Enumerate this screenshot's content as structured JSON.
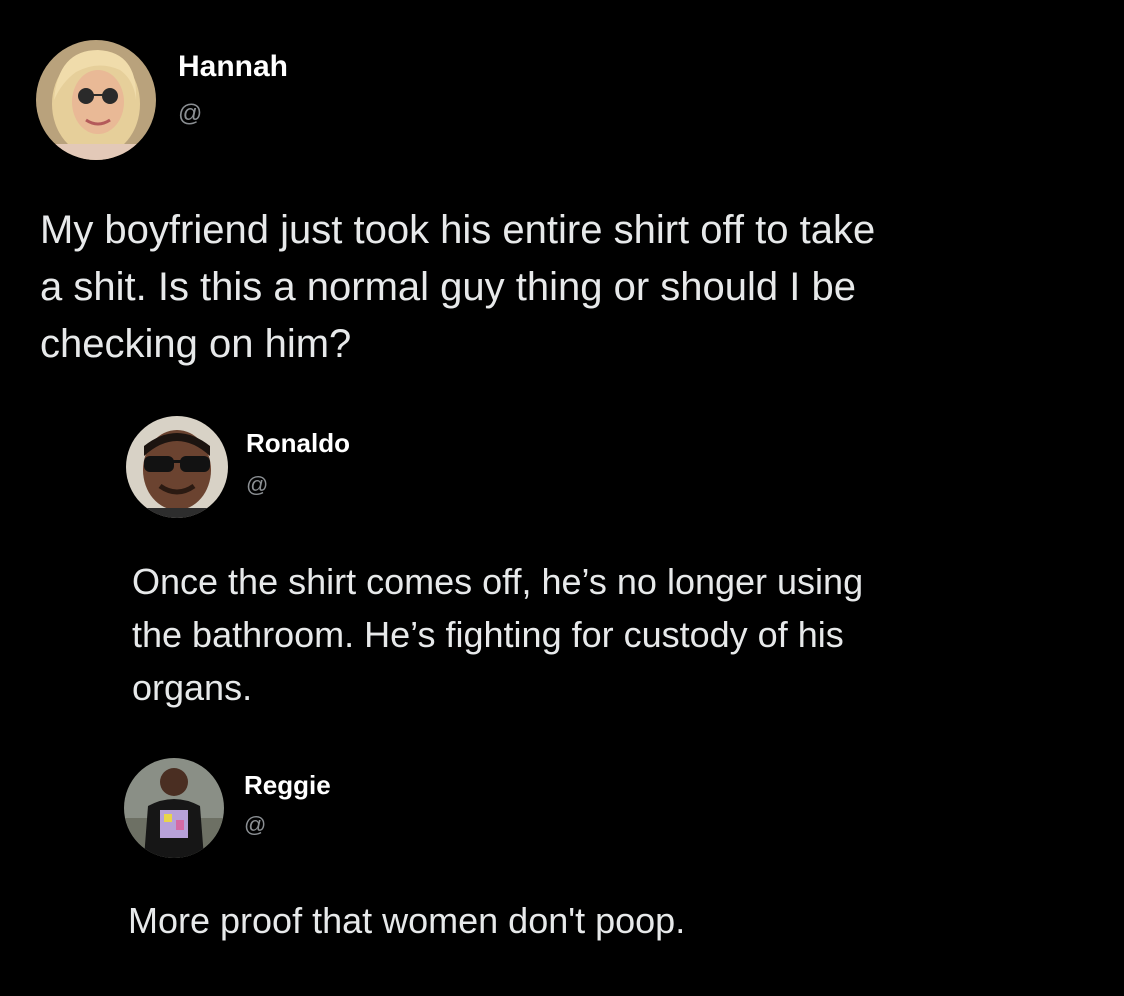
{
  "tweets": [
    {
      "name": "Hannah",
      "handle": "@",
      "avatar": "profile-photo-woman-sunglasses",
      "text": "My boyfriend just took his entire shirt off to take\na shit. Is this a normal guy thing or should I be\nchecking on him?"
    },
    {
      "name": "Ronaldo",
      "handle": "@",
      "avatar": "profile-photo-man-sunglasses",
      "text": "Once the shirt comes off, he’s no longer using\nthe bathroom. He’s fighting for custody of his\norgans."
    },
    {
      "name": "Reggie",
      "handle": "@",
      "avatar": "profile-photo-man-graphic-tee",
      "text": "More proof that women don't poop."
    }
  ],
  "colors": {
    "background": "#000000",
    "name": "#ffffff",
    "handle": "#8b8f93",
    "text": "#e7e9ea"
  }
}
